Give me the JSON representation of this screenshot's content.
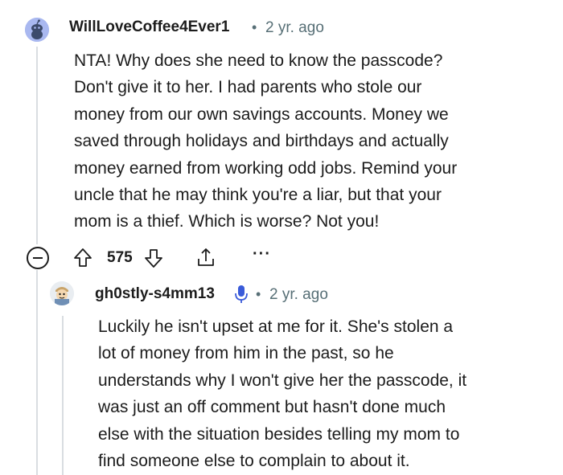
{
  "comment": {
    "author": "WillLoveCoffee4Ever1",
    "separator": "•",
    "age": "2 yr. ago",
    "body": "NTA! Why does she need to know the passcode?\nDon't give it to her. I had parents who stole our\nmoney from our own savings accounts. Money we\nsaved through holidays and birthdays and actually\nmoney earned from working odd jobs. Remind your\nuncle that he may think you're a liar, but that your\nmom is a thief. Which is worse? Not you!",
    "score": "575",
    "more_label": "···"
  },
  "reply": {
    "author": "gh0stly-s4mm13",
    "separator": "•",
    "age": "2 yr. ago",
    "body": "Luckily he isn't upset at me for it. She's stolen a\nlot of money from him in the past, so he\nunderstands why I won't give her the passcode, it\nwas just an off comment but hasn't done much\nelse with the situation besides telling my mom to\nfind someone else to complain to about it."
  },
  "icons": {
    "avatar_main": "snoo-avatar-icon",
    "avatar_reply": "custom-avatar-icon",
    "collapse": "collapse-minus-icon",
    "upvote": "arrow-up-icon",
    "downvote": "arrow-down-icon",
    "share": "share-icon",
    "mic": "microphone-icon"
  },
  "colors": {
    "text": "#1c1c1c",
    "meta": "#576f76",
    "thread_line": "#d9dde1",
    "avatar_main_bg": "#a9b8f0",
    "mic": "#3a5bd9"
  }
}
